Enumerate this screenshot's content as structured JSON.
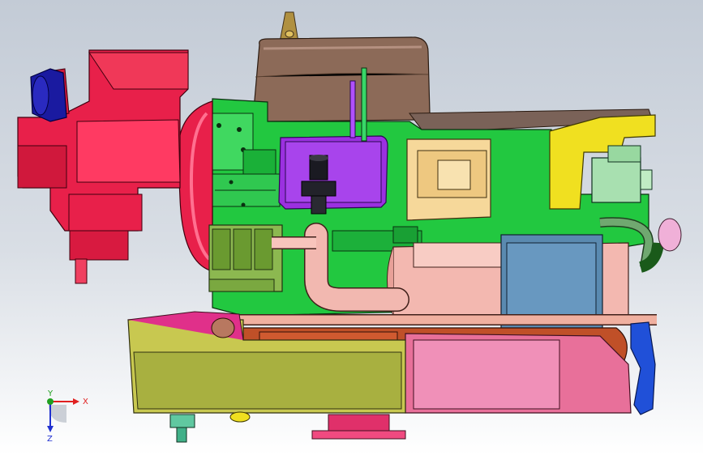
{
  "viewport": {
    "background_top": "#c3cbd6",
    "background_bottom": "#ffffff"
  },
  "triad": {
    "x_label": "X",
    "y_label": "Y",
    "z_label": "Z",
    "x_color": "#e02020",
    "y_color": "#20a020",
    "z_color": "#2030d0"
  },
  "model": {
    "components": [
      "flywheel-housing-icon",
      "water-pump-icon",
      "oil-pan-icon",
      "engine-block-icon",
      "intake-tank-icon",
      "ecu-box-icon",
      "heat-exchanger-icon",
      "exhaust-pipe-icon",
      "starter-motor-icon",
      "alternator-icon",
      "filter-cartridge-icon",
      "coolant-pipe-icon"
    ],
    "colors": {
      "housing": "#e8204a",
      "block": "#22c840",
      "tank": "#8c6a58",
      "ecu": "#9b30e0",
      "exchanger": "#f3b8b0",
      "pan": "#c8c850",
      "yellow_bracket": "#f0e020",
      "filter": "#8cb850",
      "pink_cover": "#e8709a",
      "blue_panel": "#5a8ab0"
    }
  }
}
